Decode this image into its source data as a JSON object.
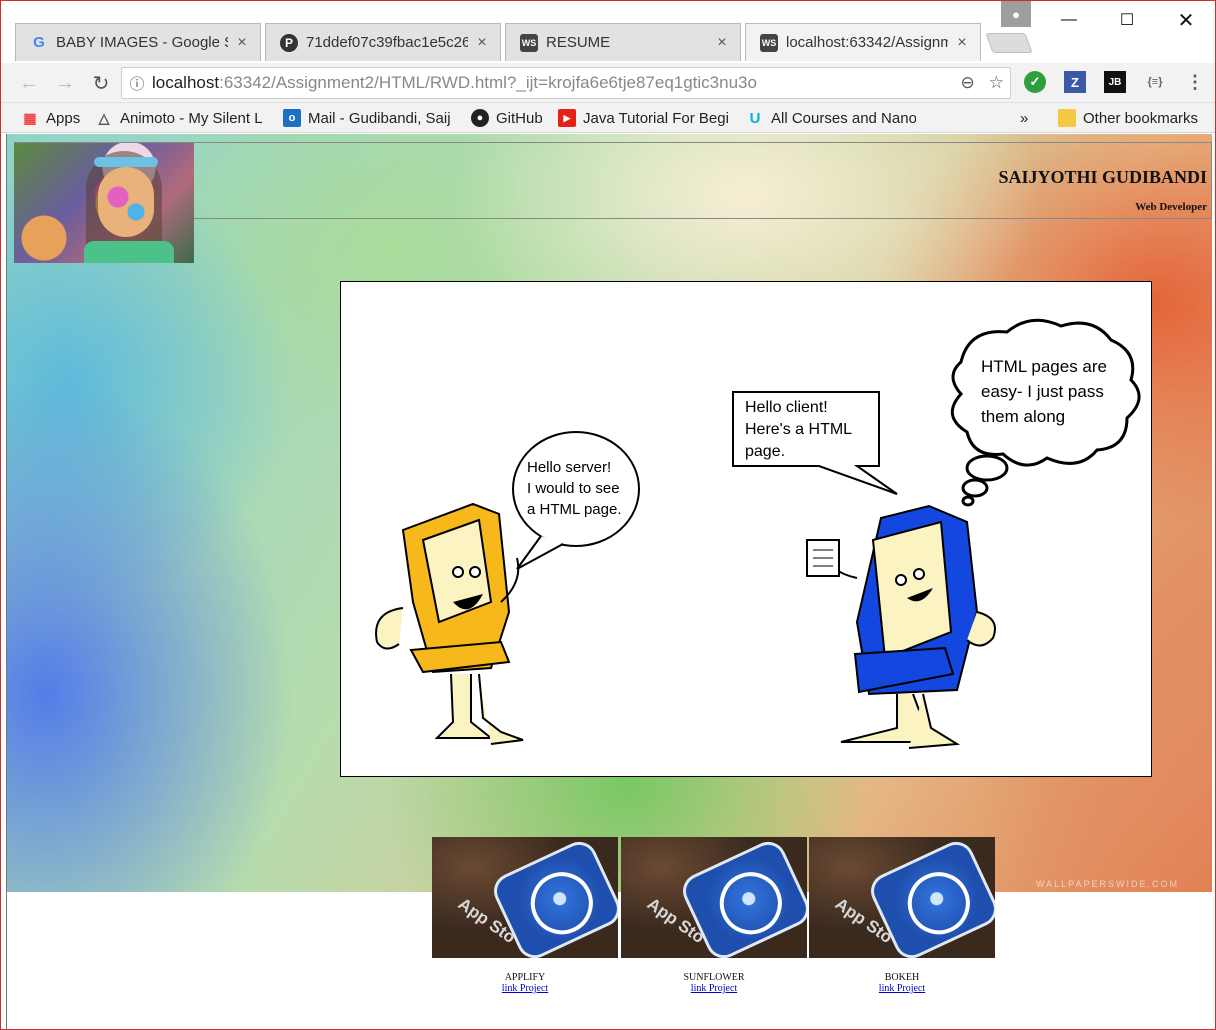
{
  "tabs": [
    {
      "title": "BABY IMAGES - Google S",
      "icon": "google-icon"
    },
    {
      "title": "71ddef07c39fbac1e5c26",
      "icon": "pinterest-icon"
    },
    {
      "title": "RESUME",
      "icon": "webstorm-icon"
    },
    {
      "title": "localhost:63342/Assignm",
      "icon": "webstorm-icon"
    }
  ],
  "address": {
    "host": "localhost",
    "path": ":63342/Assignment2/HTML/RWD.html?_ijt=krojfa6e6tje87eq1gtic3nu3o"
  },
  "bookmarks": [
    {
      "label": "Apps",
      "icon": "apps-grid-icon"
    },
    {
      "label": "Animoto - My Silent L",
      "icon": "animoto-icon"
    },
    {
      "label": "Mail - Gudibandi, Saij",
      "icon": "outlook-icon"
    },
    {
      "label": "GitHub",
      "icon": "github-icon"
    },
    {
      "label": "Java Tutorial For Begi",
      "icon": "youtube-icon"
    },
    {
      "label": "All Courses and Nano",
      "icon": "udacity-icon"
    }
  ],
  "bookmarks_more": "»",
  "other_bookmarks": "Other bookmarks",
  "extensions": [
    {
      "label": "✓",
      "icon": "check-extension-icon",
      "color": "#2e9e3e"
    },
    {
      "label": "Z",
      "icon": "zotero-icon",
      "color": "#3b5aa6"
    },
    {
      "label": "JB",
      "icon": "jetbrains-icon",
      "color": "#111111"
    },
    {
      "label": "{≡}",
      "icon": "json-viewer-icon",
      "color": "#666666"
    }
  ],
  "page": {
    "name": "SAIJYOTHI GUDIBANDI",
    "role": "Web Developer",
    "cartoon": {
      "client_speech": [
        "Hello server!",
        "I would to see",
        "a HTML page."
      ],
      "server_speech": [
        "Hello client!",
        "Here's a HTML",
        "page."
      ],
      "server_thought": [
        "HTML pages are",
        "easy- I just pass",
        "them along"
      ]
    },
    "projects": [
      {
        "title": "APPLIFY",
        "link": "link Project",
        "thumb_text": "App Sto"
      },
      {
        "title": "SUNFLOWER",
        "link": "link Project",
        "thumb_text": "App Sto"
      },
      {
        "title": "BOKEH",
        "link": "link Project",
        "thumb_text": "App Sto"
      }
    ],
    "watermark": "WALLPAPERSWIDE.COM"
  }
}
